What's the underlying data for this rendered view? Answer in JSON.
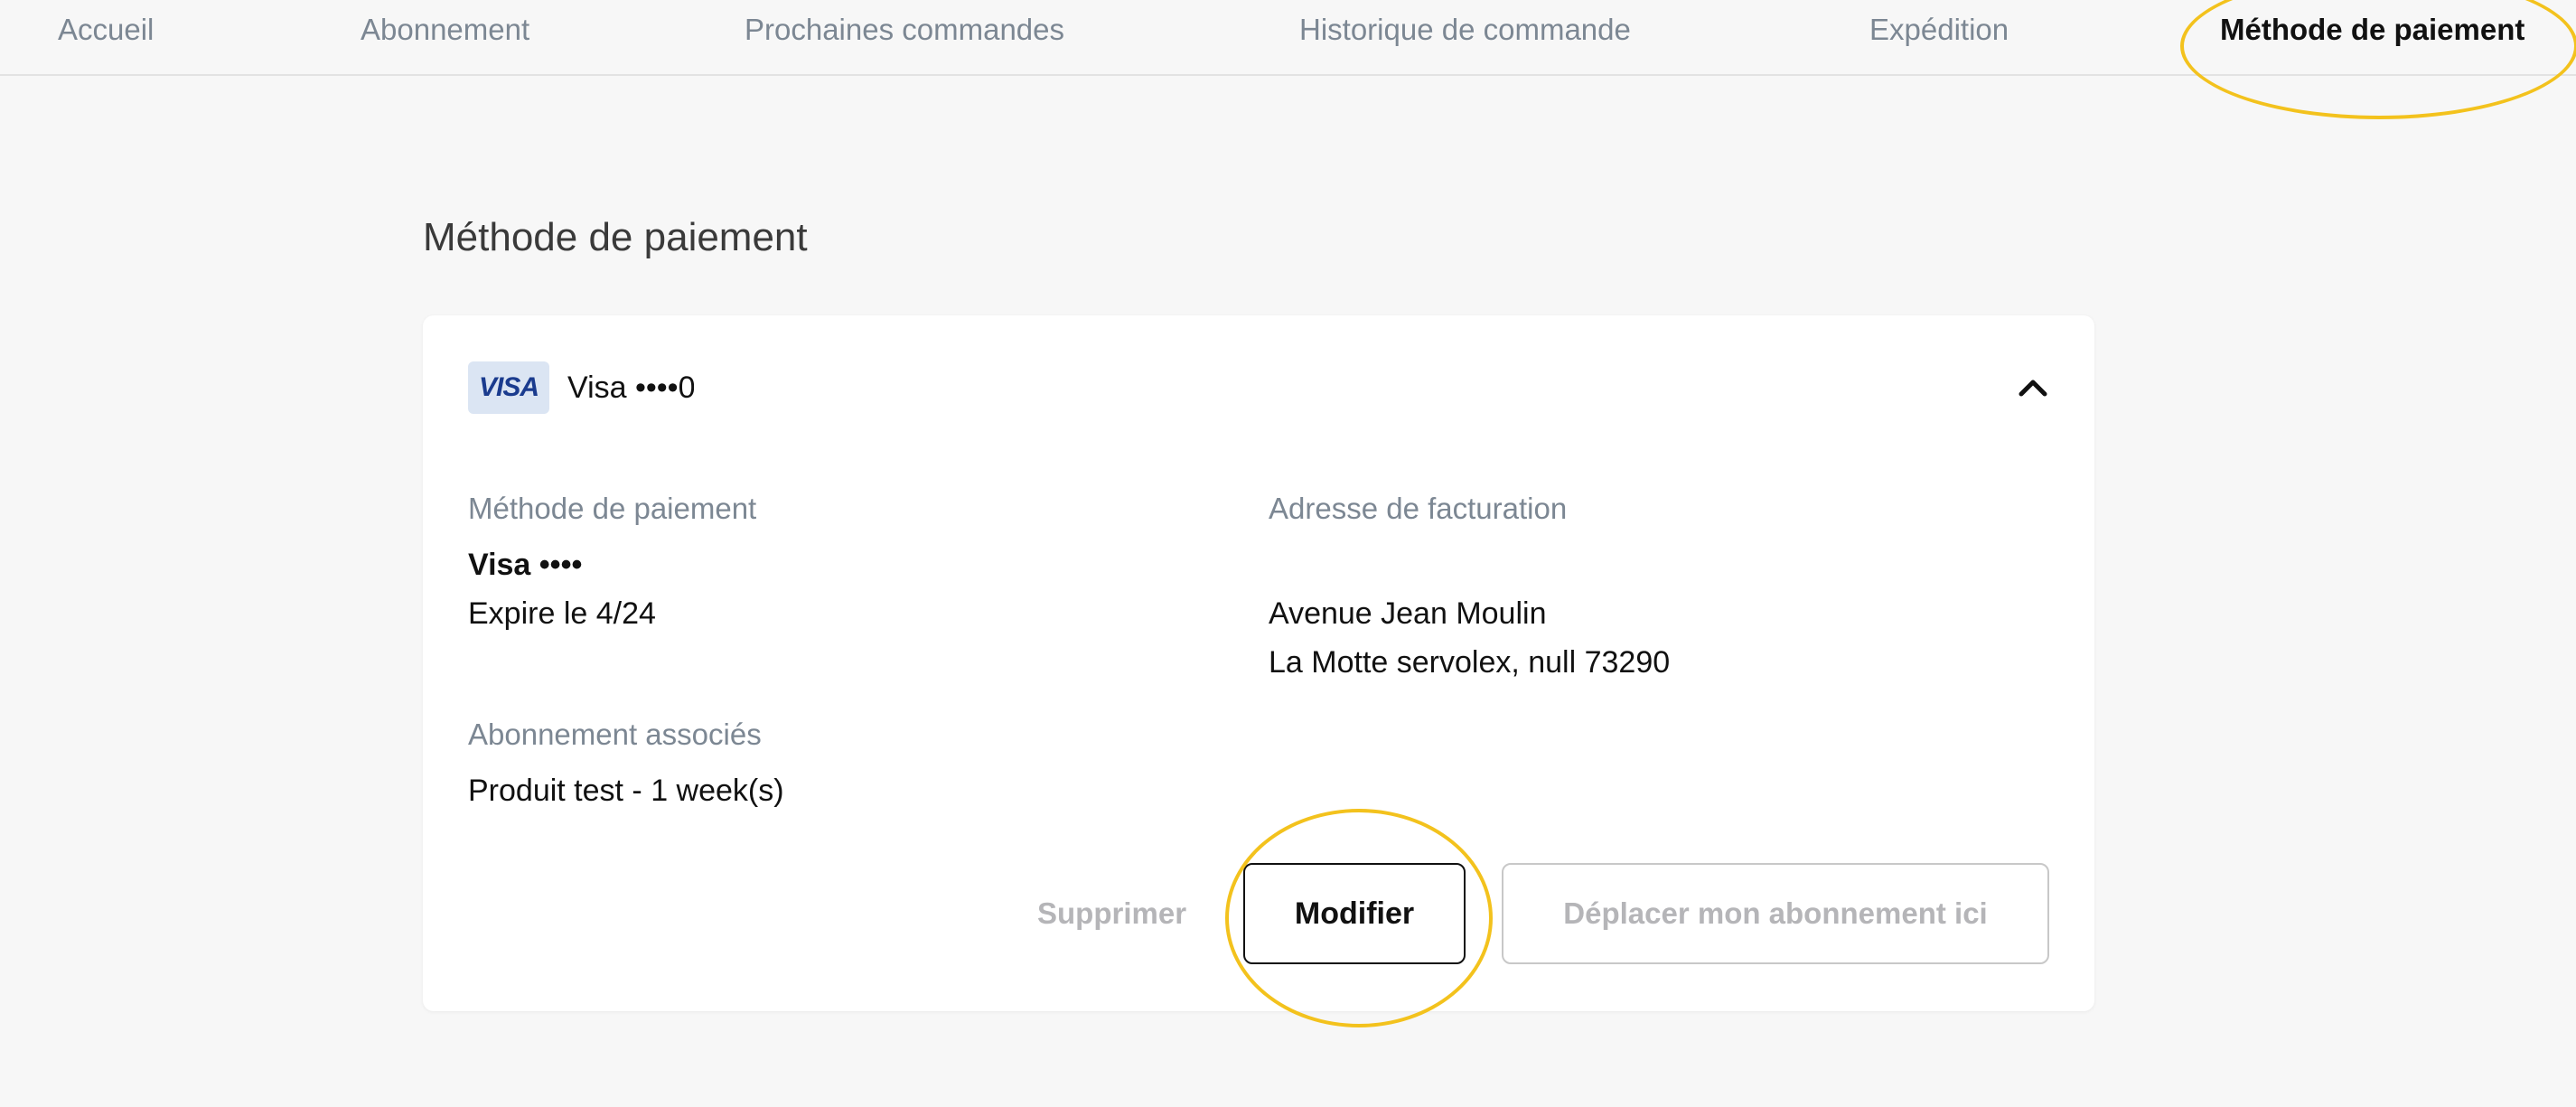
{
  "nav": {
    "items": [
      {
        "label": "Accueil",
        "active": false
      },
      {
        "label": "Abonnement",
        "active": false
      },
      {
        "label": "Prochaines commandes",
        "active": false
      },
      {
        "label": "Historique de commande",
        "active": false
      },
      {
        "label": "Expédition",
        "active": false
      },
      {
        "label": "Méthode de paiement",
        "active": true
      }
    ]
  },
  "section_title": "Méthode de paiement",
  "card": {
    "brand_logo_text": "VISA",
    "header_label": "Visa ••••0",
    "payment_method": {
      "label": "Méthode de paiement",
      "card_name": "Visa ••••",
      "expiry": "Expire le 4/24"
    },
    "billing_address": {
      "label": "Adresse de facturation",
      "line1": "Avenue Jean Moulin",
      "line2": "La Motte servolex, null 73290"
    },
    "subscriptions": {
      "label": "Abonnement associés",
      "item": "Produit test - 1 week(s)"
    },
    "buttons": {
      "delete": "Supprimer",
      "modify": "Modifier",
      "move": "Déplacer mon abonnement ici"
    }
  },
  "colors": {
    "annotation": "#f3c21d",
    "nav_inactive": "#7c8793",
    "disabled_text": "#b5b5b8",
    "visa_blue": "#1a3b8e"
  },
  "icons": {
    "collapse": "chevron-up-icon"
  }
}
